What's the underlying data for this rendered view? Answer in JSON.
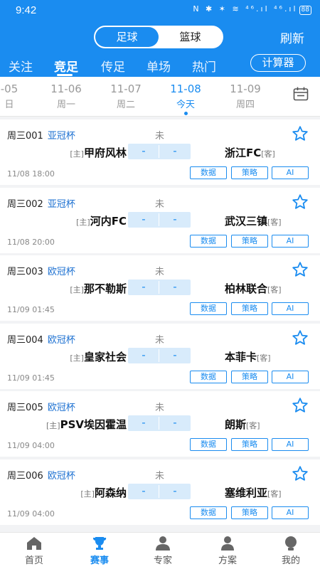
{
  "status_bar": {
    "time": "9:42",
    "icons": "N ✱ ✶ ≋ ⁴⁶.ıl ⁴⁶.ıl",
    "battery": "88"
  },
  "header": {
    "segment": {
      "football": "足球",
      "basketball": "篮球"
    },
    "refresh": "刷新",
    "tabs": [
      "关注",
      "竞足",
      "传足",
      "单场",
      "热门"
    ],
    "active_tab": "竞足",
    "calculator": "计算器"
  },
  "dates": [
    {
      "date": "-05",
      "weekday": "日"
    },
    {
      "date": "11-06",
      "weekday": "周一"
    },
    {
      "date": "11-07",
      "weekday": "周二"
    },
    {
      "date": "11-08",
      "weekday": "今天",
      "active": true
    },
    {
      "date": "11-09",
      "weekday": "周四"
    }
  ],
  "colors": {
    "accent": "#1a8cf0",
    "league": "#1a6fd1"
  },
  "button_labels": {
    "data": "数据",
    "strategy": "策略",
    "ai": "AI"
  },
  "matches": [
    {
      "code": "周三001",
      "league": "亚冠杯",
      "status": "未",
      "home_tag": "[主]",
      "home": "甲府风林",
      "score_home": "-",
      "score_away": "-",
      "away": "浙江FC",
      "away_tag": "[客]",
      "time": "11/08 18:00"
    },
    {
      "code": "周三002",
      "league": "亚冠杯",
      "status": "未",
      "home_tag": "[主]",
      "home": "河内FC",
      "score_home": "-",
      "score_away": "-",
      "away": "武汉三镇",
      "away_tag": "[客]",
      "time": "11/08 20:00"
    },
    {
      "code": "周三003",
      "league": "欧冠杯",
      "status": "未",
      "home_tag": "[主]",
      "home": "那不勒斯",
      "score_home": "-",
      "score_away": "-",
      "away": "柏林联合",
      "away_tag": "[客]",
      "time": "11/09 01:45"
    },
    {
      "code": "周三004",
      "league": "欧冠杯",
      "status": "未",
      "home_tag": "[主]",
      "home": "皇家社会",
      "score_home": "-",
      "score_away": "-",
      "away": "本菲卡",
      "away_tag": "[客]",
      "time": "11/09 01:45"
    },
    {
      "code": "周三005",
      "league": "欧冠杯",
      "status": "未",
      "home_tag": "[主]",
      "home": "PSV埃因霍温",
      "score_home": "-",
      "score_away": "-",
      "away": "朗斯",
      "away_tag": "[客]",
      "time": "11/09 04:00"
    },
    {
      "code": "周三006",
      "league": "欧冠杯",
      "status": "未",
      "home_tag": "[主]",
      "home": "阿森纳",
      "score_home": "-",
      "score_away": "-",
      "away": "塞维利亚",
      "away_tag": "[客]",
      "time": "11/09 04:00"
    }
  ],
  "bottom_nav": [
    {
      "label": "首页",
      "icon": "home-icon"
    },
    {
      "label": "赛事",
      "icon": "trophy-icon",
      "active": true
    },
    {
      "label": "专家",
      "icon": "expert-icon"
    },
    {
      "label": "方案",
      "icon": "plan-icon"
    },
    {
      "label": "我的",
      "icon": "profile-icon"
    }
  ]
}
